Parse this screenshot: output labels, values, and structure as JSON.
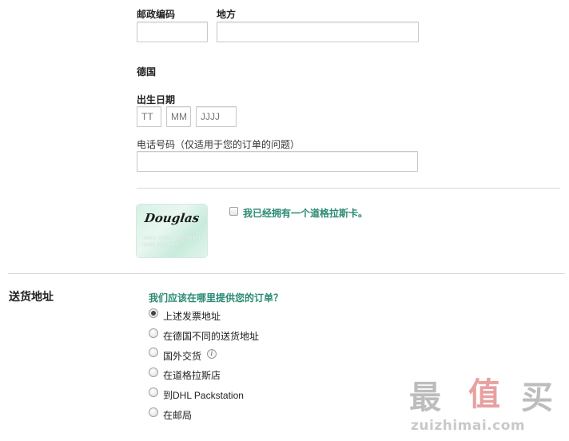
{
  "address": {
    "postcode_label": "邮政编码",
    "postcode_value": "",
    "city_label": "地方",
    "city_value": "",
    "country": "德国"
  },
  "birthdate": {
    "label": "出生日期",
    "day_placeholder": "TT",
    "month_placeholder": "MM",
    "year_placeholder": "JJJJ"
  },
  "phone": {
    "label": "电话号码（仅适用于您的订单的问题）",
    "value": ""
  },
  "card": {
    "logo_text": "Douglas",
    "number_text": "0000 0000 00000000",
    "sub_text": "00000 0000 0000",
    "checkbox_label": "我已经拥有一个道格拉斯卡。",
    "checked": false
  },
  "shipping": {
    "section_title": "送货地址",
    "question": "我们应该在哪里提供您的订单？",
    "options": [
      {
        "label": "上述发票地址",
        "checked": true
      },
      {
        "label": "在德国不同的送货地址",
        "checked": false
      },
      {
        "label": "国外交货",
        "checked": false,
        "info_icon": "info-icon"
      },
      {
        "label": "在道格拉斯店",
        "checked": false
      },
      {
        "label": "到DHL Packstation",
        "checked": false
      },
      {
        "label": "在邮局",
        "checked": false
      }
    ]
  },
  "watermark": {
    "cn_1": "最",
    "cn_2": "值",
    "cn_3": "买",
    "en": "zuizhimai.com",
    "colors": {
      "gray": "#bdbdbd",
      "red": "#e8a0a0"
    }
  },
  "colors": {
    "accent_green": "#2a8a73",
    "divider": "#d9d9d9"
  }
}
